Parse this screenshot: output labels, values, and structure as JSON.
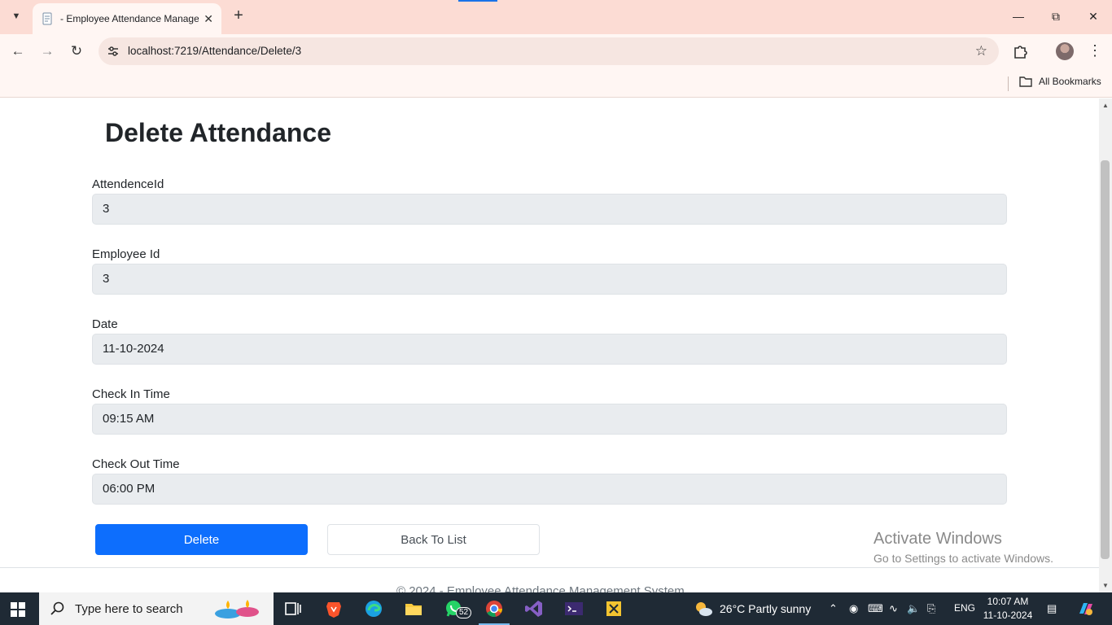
{
  "browser": {
    "tab_title": "- Employee Attendance Manage",
    "url": "localhost:7219/Attendance/Delete/3",
    "bookmarks_label": "All Bookmarks"
  },
  "page": {
    "title": "Delete Attendance",
    "fields": [
      {
        "label": "AttendenceId",
        "value": "3"
      },
      {
        "label": "Employee Id",
        "value": "3"
      },
      {
        "label": "Date",
        "value": "11-10-2024"
      },
      {
        "label": "Check In Time",
        "value": "09:15  AM"
      },
      {
        "label": "Check Out Time",
        "value": "06:00  PM"
      }
    ],
    "delete_label": "Delete",
    "back_label": "Back To List",
    "footer": "© 2024 - Employee Attendance Management System"
  },
  "watermark": {
    "line1": "Activate Windows",
    "line2": "Go to Settings to activate Windows."
  },
  "taskbar": {
    "search_placeholder": "Type here to search",
    "whatsapp_badge": "52",
    "weather": "26°C  Partly sunny",
    "language": "ENG",
    "time": "10:07 AM",
    "date": "11-10-2024"
  },
  "colors": {
    "primary": "#0d6efd",
    "readonly_bg": "#e9ecef",
    "chrome_bg": "#fcdcd4",
    "taskbar_bg": "#1f2a35"
  }
}
